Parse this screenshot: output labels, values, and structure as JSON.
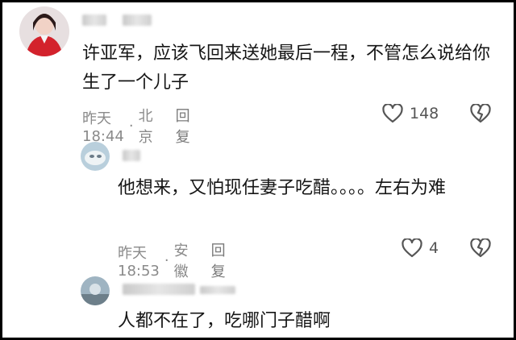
{
  "comments": [
    {
      "text": "许亚军，应该飞回来送她最后一程，不管怎么说给你生了一个儿子",
      "time": "昨天18:44",
      "location": "北京",
      "reply_label": "回复",
      "like_count": "148"
    },
    {
      "text": "他想来，又怕现任妻子吃醋。。。。左右为难",
      "time": "昨天18:53",
      "location": "安徽",
      "reply_label": "回复",
      "like_count": "4"
    },
    {
      "text": "人都不在了，吃哪门子醋啊"
    }
  ],
  "colors": {
    "text": "#161616",
    "meta": "#8a8a8a",
    "icon": "#555555"
  },
  "icons": [
    "heart-outline",
    "broken-heart"
  ]
}
